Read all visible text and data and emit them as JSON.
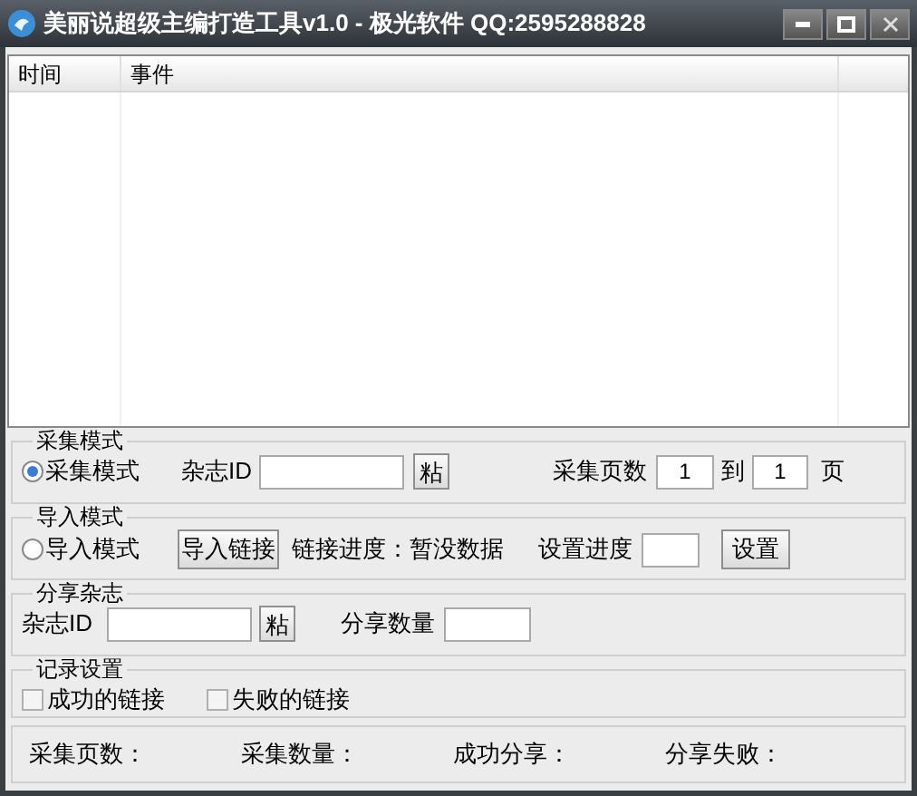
{
  "window": {
    "title": "美丽说超级主编打造工具v1.0 - 极光软件 QQ:2595288828"
  },
  "log_table": {
    "columns": [
      "时间",
      "事件"
    ]
  },
  "collect_mode": {
    "title": "采集模式",
    "mode_radio": {
      "label": "采集模式",
      "selected": true
    },
    "magazine_id_label": "杂志ID",
    "paste_button": "粘",
    "pages_label": "采集页数",
    "page_from": "1",
    "to_label": "到",
    "page_to": "1",
    "page_unit": "页"
  },
  "import_mode": {
    "title": "导入模式",
    "mode_radio": {
      "label": "导入模式",
      "selected": false
    },
    "import_button": "导入链接",
    "progress_text": "链接进度：暂没数据",
    "set_progress_label": "设置进度",
    "set_button": "设置"
  },
  "share_magazine": {
    "title": "分享杂志",
    "magazine_id_label": "杂志ID",
    "paste_button": "粘",
    "share_count_label": "分享数量"
  },
  "log_settings": {
    "title": "记录设置",
    "checkboxes": [
      {
        "label": "成功的链接",
        "checked": false
      },
      {
        "label": "失败的链接",
        "checked": false
      }
    ]
  },
  "status_bar": [
    "采集页数：",
    "采集数量：",
    "成功分享：",
    "分享失败："
  ]
}
